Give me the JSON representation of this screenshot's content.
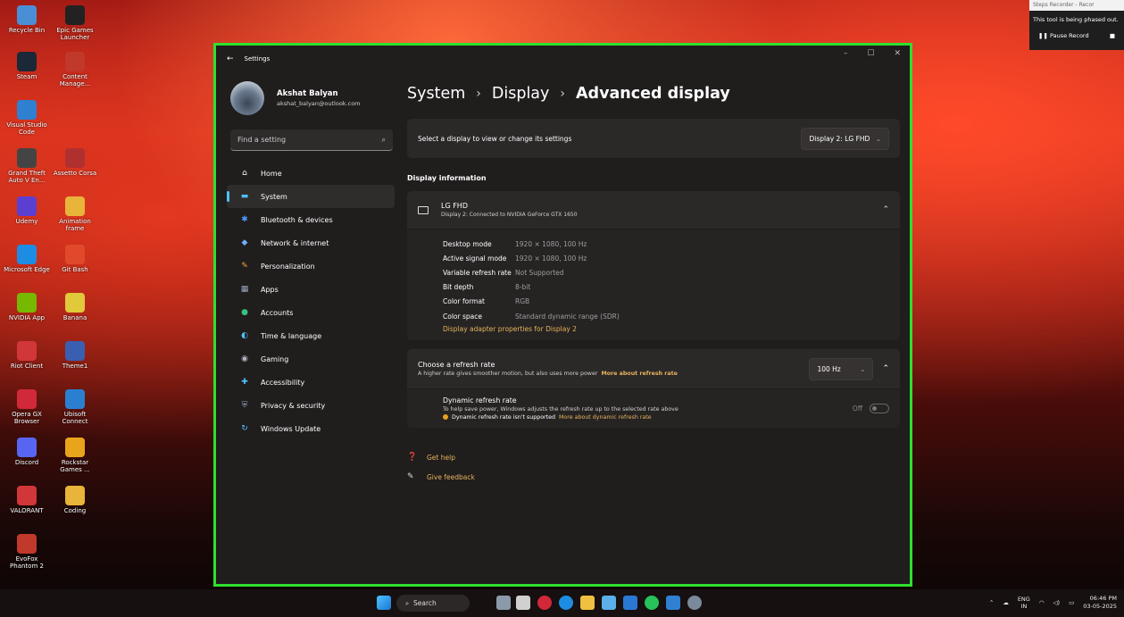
{
  "desktop": {
    "icons": [
      {
        "label": "Recycle Bin",
        "color": "#4a8fd6"
      },
      {
        "label": "Epic Games Launcher",
        "color": "#222222"
      },
      {
        "label": "Steam",
        "color": "#1b2838"
      },
      {
        "label": "Content Manage...",
        "color": "#c0392b"
      },
      {
        "label": "Visual Studio Code",
        "color": "#2f80d1"
      },
      {
        "label": "Grand Theft Auto V En...",
        "color": "#444444"
      },
      {
        "label": "Assetto Corsa",
        "color": "#b03030"
      },
      {
        "label": "Udemy",
        "color": "#5b3fd1"
      },
      {
        "label": "Animation frame",
        "color": "#e8b43a"
      },
      {
        "label": "Microsoft Edge",
        "color": "#1d8de3"
      },
      {
        "label": "Git Bash",
        "color": "#e04a2a"
      },
      {
        "label": "NVIDIA App",
        "color": "#76b900"
      },
      {
        "label": "Banana",
        "color": "#e0c93a"
      },
      {
        "label": "Riot Client",
        "color": "#d13639"
      },
      {
        "label": "Theme1",
        "color": "#3a5fb0"
      },
      {
        "label": "Opera GX Browser",
        "color": "#d1283a"
      },
      {
        "label": "Ubisoft Connect",
        "color": "#2a7fd1"
      },
      {
        "label": "Discord",
        "color": "#5865f2"
      },
      {
        "label": "Rockstar Games ...",
        "color": "#e8a41a"
      },
      {
        "label": "VALORANT",
        "color": "#d13639"
      },
      {
        "label": "Coding",
        "color": "#e8b43a"
      },
      {
        "label": "EvoFox Phantom 2",
        "color": "#c0392b"
      }
    ]
  },
  "steps_recorder": {
    "title": "Steps Recorder - Recor",
    "notice": "This tool is being phased out.",
    "pause_label": "Pause Record"
  },
  "window": {
    "title": "Settings",
    "controls": {
      "minimize": "–",
      "maximize": "☐",
      "close": "✕"
    }
  },
  "profile": {
    "name": "Akshat Balyan",
    "email": "akshat_balyan@outlook.com"
  },
  "search": {
    "placeholder": "Find a setting"
  },
  "nav": [
    {
      "label": "Home",
      "icon": "home-icon",
      "glyph": "⌂",
      "color": "#ffffff"
    },
    {
      "label": "System",
      "icon": "system-icon",
      "glyph": "▬",
      "color": "#4cc2ff",
      "active": true
    },
    {
      "label": "Bluetooth & devices",
      "icon": "bluetooth-icon",
      "glyph": "✱",
      "color": "#4c9aff"
    },
    {
      "label": "Network & internet",
      "icon": "network-icon",
      "glyph": "◆",
      "color": "#6fb1ff"
    },
    {
      "label": "Personalization",
      "icon": "brush-icon",
      "glyph": "✎",
      "color": "#f0a640"
    },
    {
      "label": "Apps",
      "icon": "apps-icon",
      "glyph": "▦",
      "color": "#9aa6c0"
    },
    {
      "label": "Accounts",
      "icon": "accounts-icon",
      "glyph": "●",
      "color": "#37c27f"
    },
    {
      "label": "Time & language",
      "icon": "globe-icon",
      "glyph": "◐",
      "color": "#4cc2ff"
    },
    {
      "label": "Gaming",
      "icon": "gaming-icon",
      "glyph": "◉",
      "color": "#b8b8c8"
    },
    {
      "label": "Accessibility",
      "icon": "accessibility-icon",
      "glyph": "✚",
      "color": "#4cc2ff"
    },
    {
      "label": "Privacy & security",
      "icon": "shield-icon",
      "glyph": "⛨",
      "color": "#9aa6c0"
    },
    {
      "label": "Windows Update",
      "icon": "update-icon",
      "glyph": "↻",
      "color": "#4cc2ff"
    }
  ],
  "breadcrumb": {
    "system": "System",
    "display": "Display",
    "current": "Advanced display",
    "sep": "›"
  },
  "display_select": {
    "label": "Select a display to view or change its settings",
    "value": "Display 2: LG FHD"
  },
  "display_info": {
    "section_title": "Display information",
    "monitor_name": "LG FHD",
    "monitor_sub": "Display 2: Connected to NVIDIA GeForce GTX 1650",
    "rows": [
      {
        "k": "Desktop mode",
        "v": "1920 × 1080, 100 Hz"
      },
      {
        "k": "Active signal mode",
        "v": "1920 × 1080, 100 Hz"
      },
      {
        "k": "Variable refresh rate",
        "v": "Not Supported"
      },
      {
        "k": "Bit depth",
        "v": "8-bit"
      },
      {
        "k": "Color format",
        "v": "RGB"
      },
      {
        "k": "Color space",
        "v": "Standard dynamic range (SDR)"
      }
    ],
    "adapter_link": "Display adapter properties for Display 2"
  },
  "refresh": {
    "title": "Choose a refresh rate",
    "sub": "A higher rate gives smoother motion, but also uses more power",
    "link": "More about refresh rate",
    "value": "100 Hz",
    "dynamic_title": "Dynamic refresh rate",
    "dynamic_sub": "To help save power, Windows adjusts the refresh rate up to the selected rate above",
    "dynamic_warn": "Dynamic refresh rate isn't supported",
    "dynamic_link": "More about dynamic refresh rate",
    "toggle_label": "Off"
  },
  "help": {
    "get_help": "Get help",
    "feedback": "Give feedback"
  },
  "taskbar": {
    "search": "Search",
    "lang_top": "ENG",
    "lang_bottom": "IN",
    "time": "06:46 PM",
    "date": "03-05-2025"
  }
}
